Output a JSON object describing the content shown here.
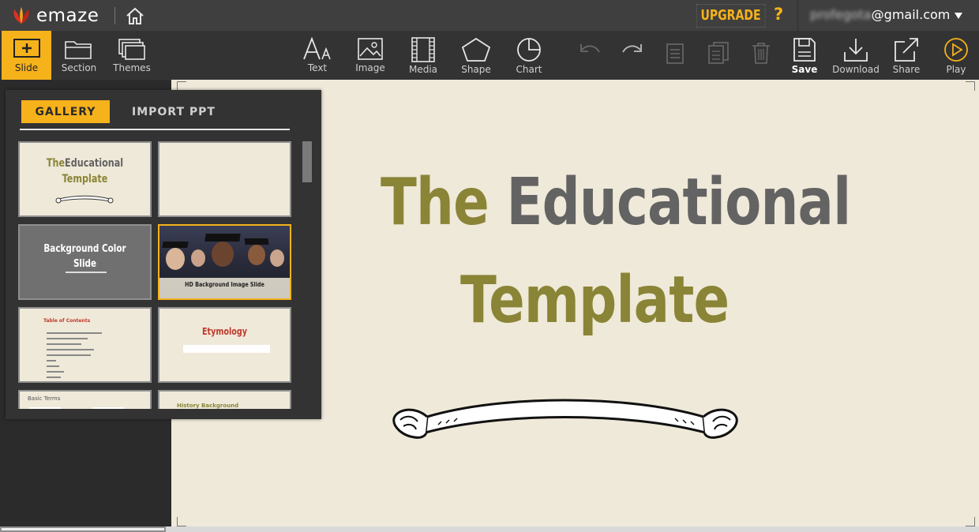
{
  "app": {
    "logo_text": "emaze",
    "upgrade_label": "UPGRADE",
    "help_label": "?",
    "account_blurred": "profegota",
    "account_domain": "@gmail.com"
  },
  "toolbar": {
    "slide": "Slide",
    "section": "Section",
    "themes": "Themes",
    "text": "Text",
    "image": "Image",
    "media": "Media",
    "shape": "Shape",
    "chart": "Chart",
    "save": "Save",
    "download": "Download",
    "share": "Share",
    "play": "Play"
  },
  "gallery": {
    "tab_gallery": "GALLERY",
    "tab_import": "IMPORT PPT",
    "thumbs": [
      {
        "title_a": "The",
        "title_b": "Educational",
        "title_c": "Template"
      },
      {
        "title": ""
      },
      {
        "title": "Background Color Slide"
      },
      {
        "title": "HD Background Image Slide"
      },
      {
        "title": "Table of Contents"
      },
      {
        "title": "Etymology"
      },
      {
        "title": "Basic Terms"
      },
      {
        "title": "History Background"
      }
    ]
  },
  "slide": {
    "title_word1": "The",
    "title_word2": "Educational",
    "title_line2": "Template"
  },
  "colors": {
    "accent": "#f6b21b",
    "olive": "#8a8437",
    "title_gray": "#636363",
    "canvas_bg": "#efe9d9"
  }
}
